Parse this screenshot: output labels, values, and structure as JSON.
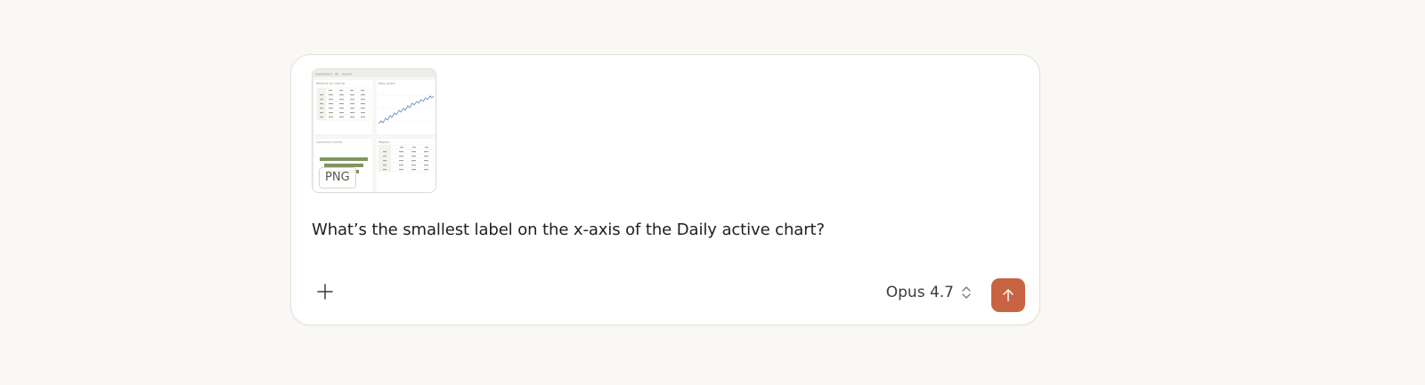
{
  "composer": {
    "attachment": {
      "type_badge": "PNG",
      "thumbnail": {
        "tabs": [
          "Dashboard",
          "All",
          "Export"
        ],
        "panels": [
          "Revenue by channel",
          "Daily active",
          "Conversion funnel",
          "Regions"
        ]
      }
    },
    "prompt": "What’s the smallest label on the x-axis of the Daily active chart?",
    "add_icon": "plus-icon",
    "model": {
      "label": "Opus 4.7",
      "icon": "chevron-up-down-icon"
    },
    "send": {
      "icon": "arrow-up-icon",
      "color": "#c96442"
    }
  }
}
